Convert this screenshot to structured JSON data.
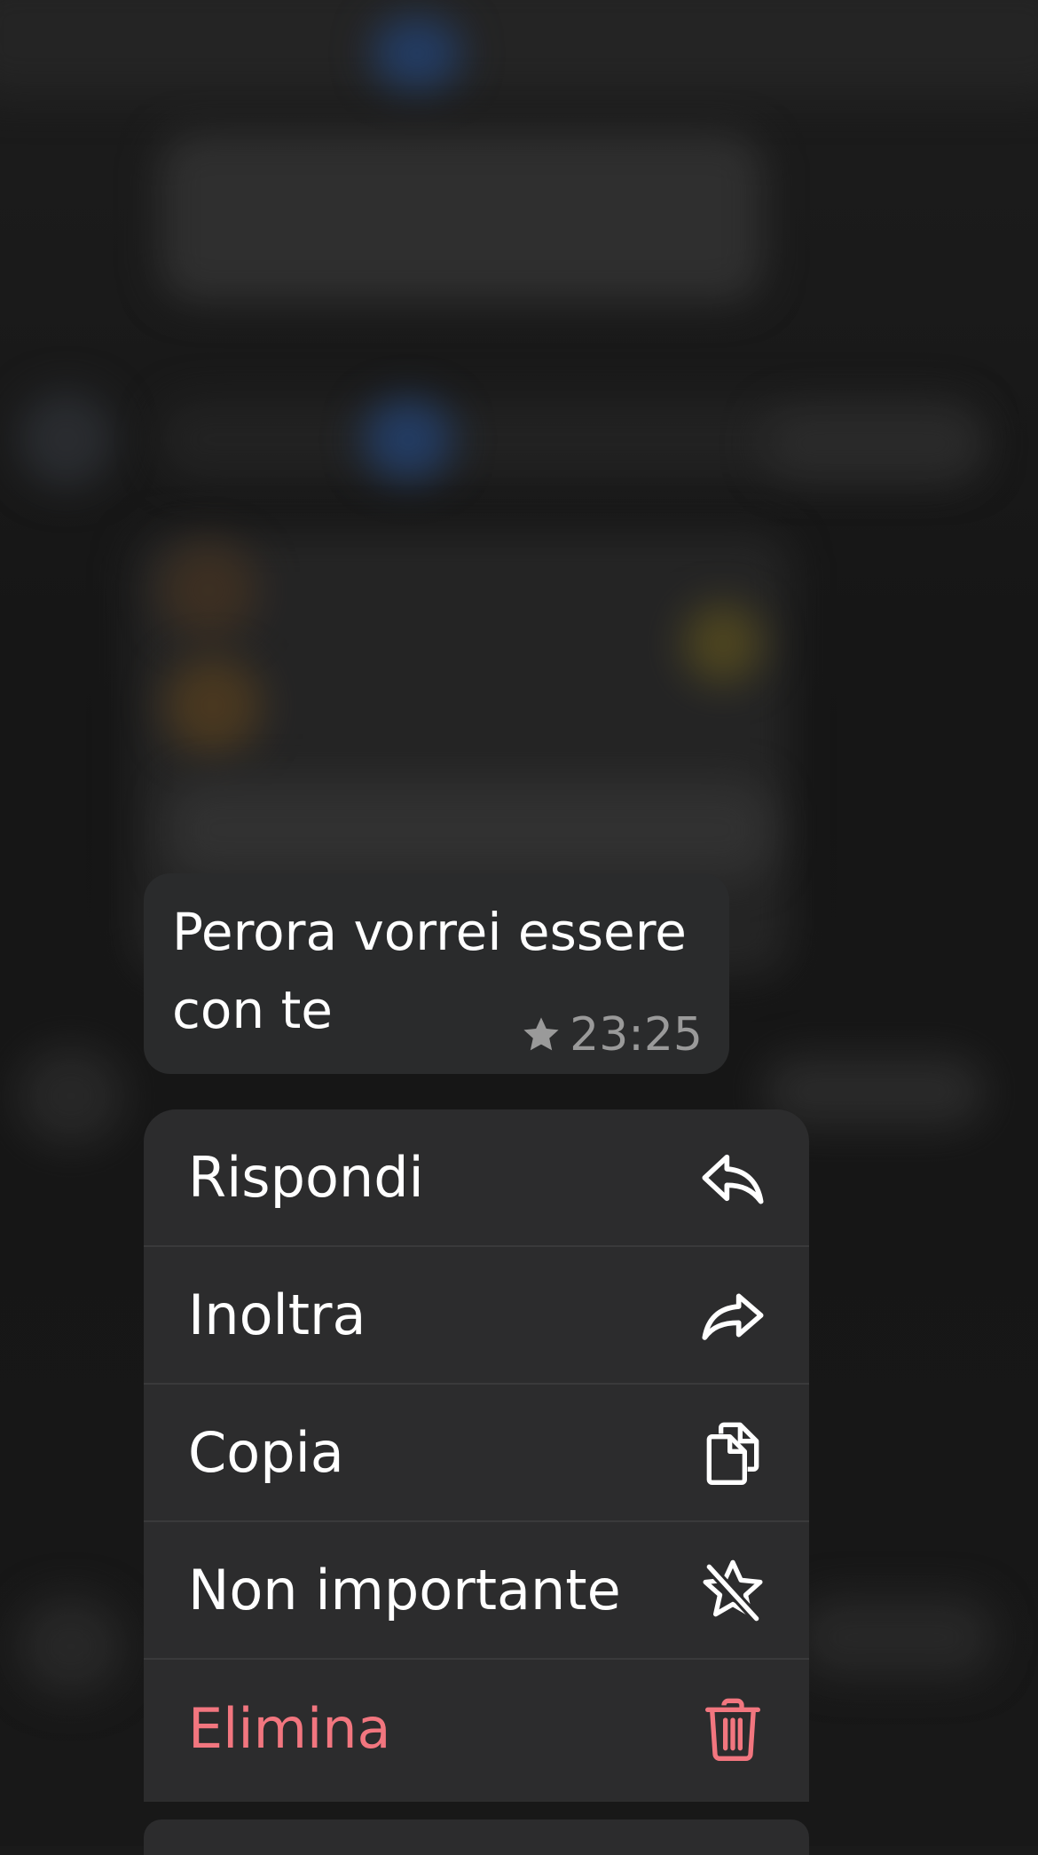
{
  "message": {
    "lines": [
      "Perora vorrei essere",
      "con te"
    ],
    "time": "23:25",
    "starred": true,
    "icon": "star-icon"
  },
  "menu": {
    "items": [
      {
        "label": "Rispondi",
        "icon": "reply-icon"
      },
      {
        "label": "Inoltra",
        "icon": "forward-icon"
      },
      {
        "label": "Copia",
        "icon": "copy-icon"
      },
      {
        "label": "Non importante",
        "icon": "unstar-icon"
      },
      {
        "label": "Elimina",
        "icon": "trash-icon",
        "destructive": true
      }
    ]
  },
  "colors": {
    "background": "#1a1a1a",
    "bubble": "#2a2b2c",
    "menu": "#2c2c2d",
    "separator": "#3a3a3b",
    "text": "#ffffff",
    "meta": "#9a9a9a",
    "destructive": "#f2767f"
  }
}
